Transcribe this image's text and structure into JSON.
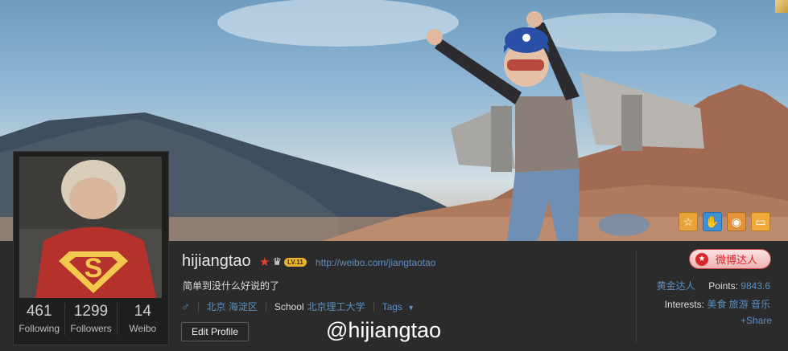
{
  "profile": {
    "username": "hijiangtao",
    "level_badge": "LV.11",
    "url": "http://weibo.com/jiangtaotao",
    "intro": "简单到没什么好说的了",
    "location": "北京 海淀区",
    "school_label": "School",
    "school": "北京理工大学",
    "tags_label": "Tags",
    "edit_button": "Edit Profile"
  },
  "stats": [
    {
      "value": "461",
      "label": "Following"
    },
    {
      "value": "1299",
      "label": "Followers"
    },
    {
      "value": "14",
      "label": "Weibo"
    }
  ],
  "sidebar": {
    "daren_button": "微博达人",
    "title": "黄金达人",
    "points_label": "Points:",
    "points_value": "9843.6",
    "interests_label": "Interests:",
    "interests_value": "美食 旅游 音乐",
    "share": "+Share"
  },
  "watermark": "@hijiangtao",
  "badges": [
    "star-badge-icon",
    "hand-badge-icon",
    "location-badge-icon",
    "chat-badge-icon"
  ],
  "colors": {
    "link": "#5b8fc2",
    "accent_red": "#d7262b",
    "bar_bg": "#2b2b2b"
  }
}
